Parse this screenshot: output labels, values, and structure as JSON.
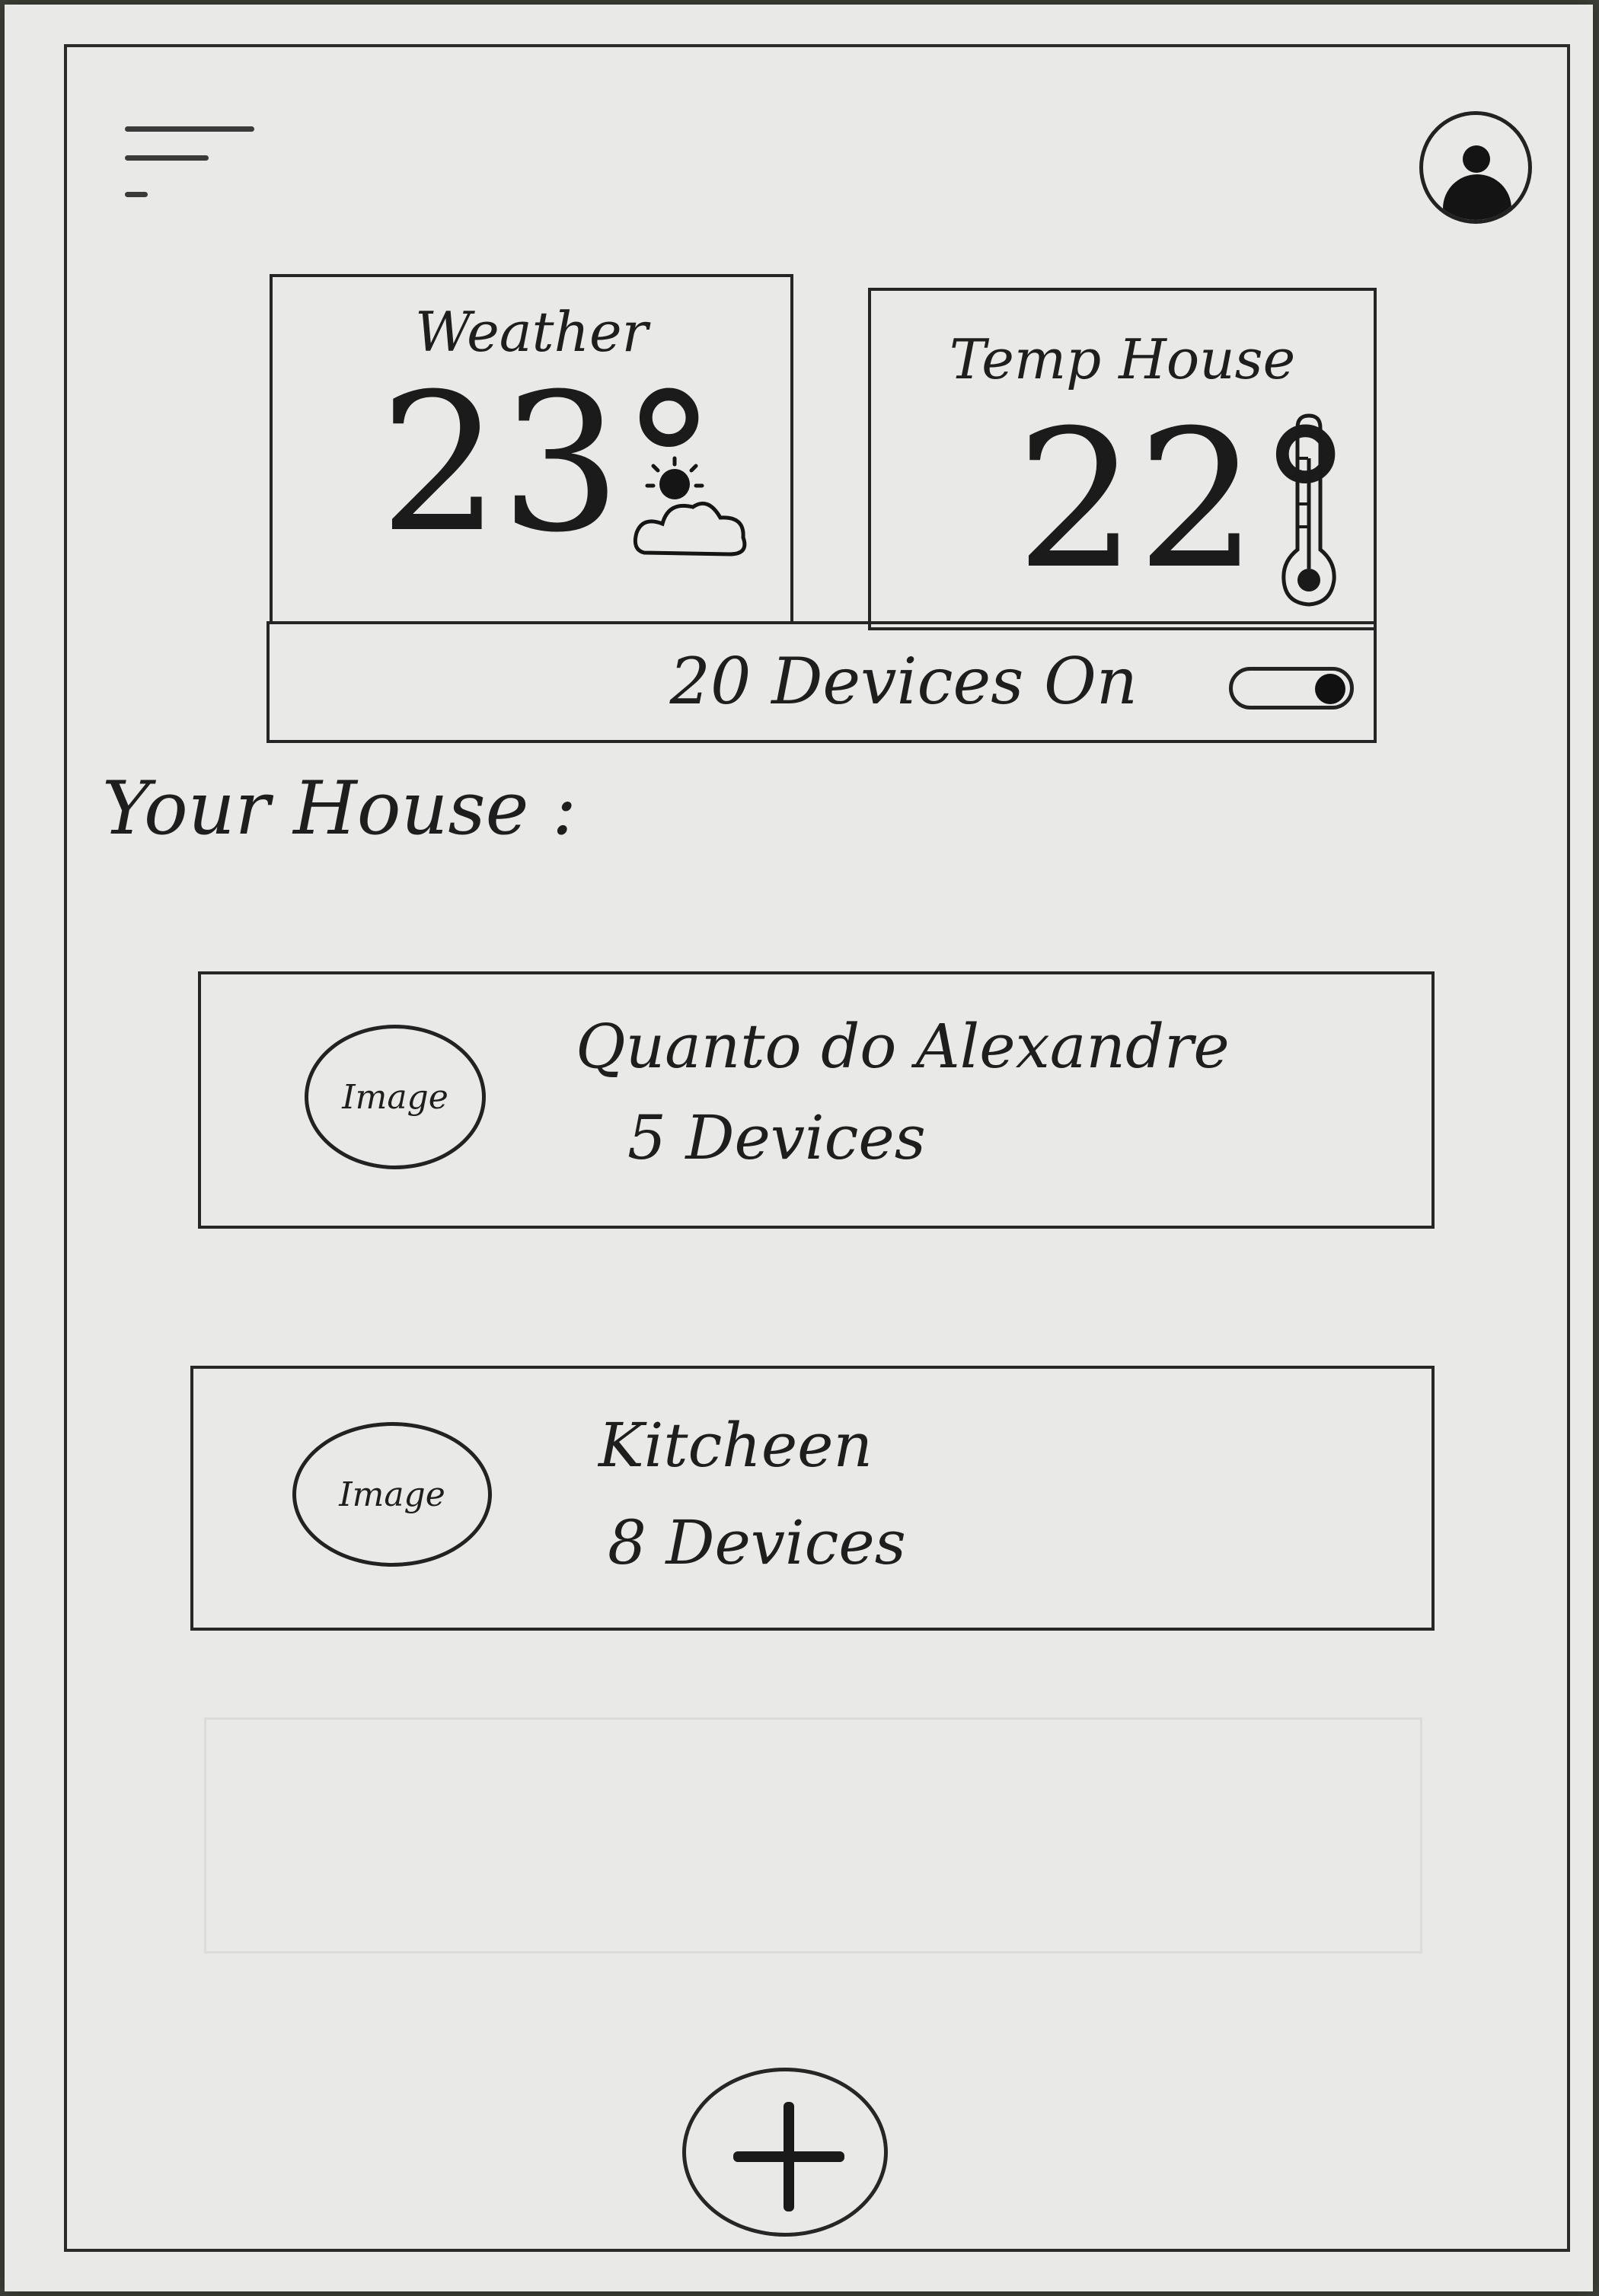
{
  "header": {
    "menu_icon": "hamburger-menu-icon",
    "avatar_icon": "user-avatar-icon"
  },
  "weather": {
    "title": "Weather",
    "value": "23°",
    "icon": "partly-sunny-icon"
  },
  "house_temp": {
    "title": "Temp House",
    "value": "22°",
    "icon": "thermometer-icon"
  },
  "devices": {
    "label": "20 Devices On",
    "toggle_on": true
  },
  "section": {
    "title": "Your House :"
  },
  "rooms": [
    {
      "image_label": "Image",
      "name": "Quanto do Alexandre",
      "devices": "5 Devices"
    },
    {
      "image_label": "Image",
      "name": "Kitcheen",
      "devices": "8 Devices"
    }
  ],
  "fab": {
    "icon": "plus-icon"
  }
}
